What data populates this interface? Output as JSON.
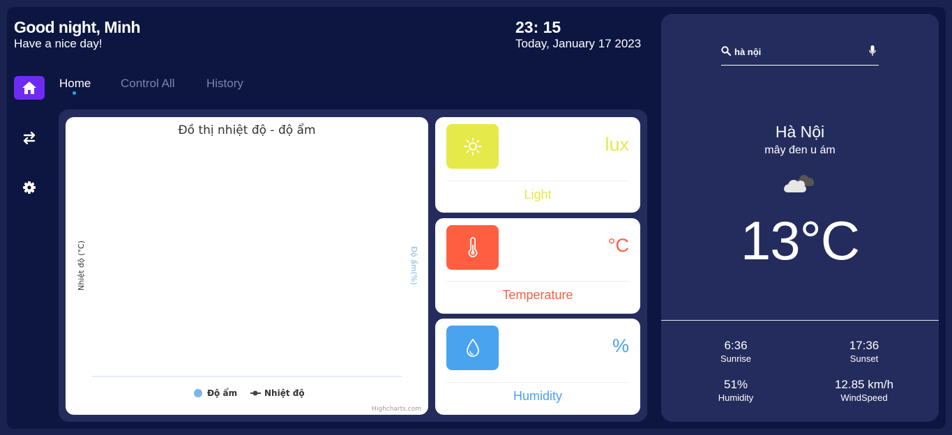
{
  "header": {
    "greeting": "Good night, Minh",
    "subtitle": "Have a nice day!",
    "time": "23: 15",
    "date": "Today, January 17 2023"
  },
  "nav": {
    "tabs": [
      {
        "label": "Home",
        "active": true
      },
      {
        "label": "Control All",
        "active": false
      },
      {
        "label": "History",
        "active": false
      }
    ]
  },
  "sidebar": {
    "icons": [
      "home-icon",
      "swap-icon",
      "gear-icon"
    ],
    "accent": "#6f2bf3"
  },
  "chart_data": {
    "type": "line",
    "title": "Đồ thị nhiệt độ - độ ẩm",
    "ylabel_left": "Nhiệt độ (°C)",
    "ylabel_right": "Độ ẩm(%)",
    "series": [
      {
        "name": "Độ ẩm",
        "values": [],
        "color": "#7cb5ec"
      },
      {
        "name": "Nhiệt độ",
        "values": [],
        "color": "#434348"
      }
    ],
    "legend_position": "bottom",
    "credits": "Highcharts.com"
  },
  "sensors": [
    {
      "name": "Light",
      "unit": "lux",
      "color": "#e6e94a",
      "icon": "sun-icon"
    },
    {
      "name": "Temperature",
      "unit": "°C",
      "color": "#ff5e41",
      "icon": "thermometer-icon"
    },
    {
      "name": "Humidity",
      "unit": "%",
      "color": "#4aa3ef",
      "icon": "droplet-icon"
    }
  ],
  "weather": {
    "search_value": "hà nội",
    "city": "Hà Nội",
    "description": "mây đen u ám",
    "icon": "cloud-icon",
    "temperature": "13°C",
    "stats": [
      {
        "value": "6:36",
        "label": "Sunrise"
      },
      {
        "value": "17:36",
        "label": "Sunset"
      },
      {
        "value": "51%",
        "label": "Humidity"
      },
      {
        "value": "12.85 km/h",
        "label": "WindSpeed"
      }
    ]
  }
}
